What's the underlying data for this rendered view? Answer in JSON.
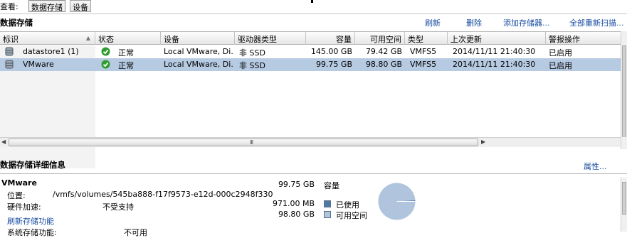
{
  "viewbar": {
    "label": "查看:",
    "tabs": [
      "数据存储",
      "设备"
    ]
  },
  "datastores": {
    "title": "数据存储",
    "actions": [
      "刷新",
      "删除",
      "添加存储器...",
      "全部重新扫描..."
    ],
    "columns": [
      "标识",
      "状态",
      "设备",
      "驱动器类型",
      "容量",
      "可用空间",
      "类型",
      "上次更新",
      "警报操作"
    ],
    "rows": [
      {
        "name": "datastore1 (1)",
        "status": "正常",
        "device": "Local VMware, Di...",
        "drive_type": "非 SSD",
        "capacity": "145.00 GB",
        "free": "79.42 GB",
        "type": "VMFS5",
        "last_update": "2014/11/11 21:40:30",
        "alarm": "已启用"
      },
      {
        "name": "VMware",
        "status": "正常",
        "device": "Local VMware, Di...",
        "drive_type": "非 SSD",
        "capacity": "99.75 GB",
        "free": "98.80 GB",
        "type": "VMFS5",
        "last_update": "2014/11/11 21:40:30",
        "alarm": "已启用"
      }
    ],
    "selected_index": 1,
    "scroll_grip": "III"
  },
  "details": {
    "title": "数据存储详细信息",
    "properties_link": "属性...",
    "name": "VMware",
    "location_label": "位置:",
    "location": "/vmfs/volumes/545ba888-f17f9573-e12d-000c2948f330",
    "hw_accel_label": "硬件加速:",
    "hw_accel": "不受支持",
    "refresh_link": "刷新存储功能",
    "sys_cap_label": "系统存储功能:",
    "sys_cap": "不可用",
    "capacity_value": "99.75 GB",
    "capacity_label": "容量",
    "used_value": "971.00 MB",
    "used_label": "已使用",
    "free_value": "98.80 GB",
    "free_label": "可用空间",
    "used_fraction": 0.0095
  },
  "colors": {
    "link": "#1a4ea2",
    "selection": "#b6cae2",
    "used": "#4f7aa8",
    "free": "#b0c4de",
    "ok": "#2e9d2e"
  }
}
